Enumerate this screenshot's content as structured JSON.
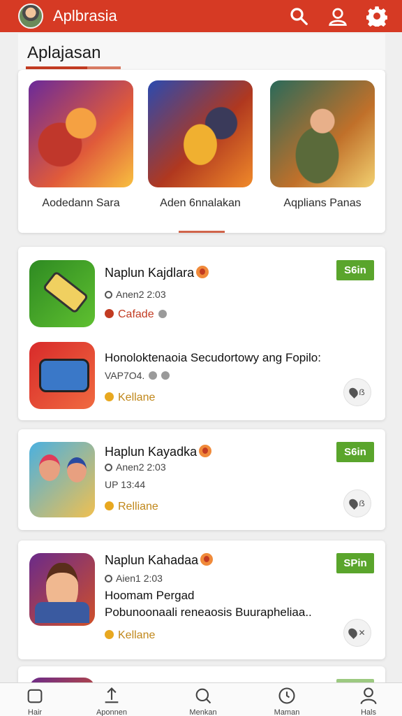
{
  "header": {
    "app_title": "Aplbrasia",
    "icons": [
      "search-icon",
      "profile-icon",
      "settings-icon"
    ],
    "accent_color": "#d63a24"
  },
  "section": {
    "title": "Aplajasan"
  },
  "featured": [
    {
      "label": "Aodedann Sara"
    },
    {
      "label": "Aden 6nnalakan"
    },
    {
      "label": "Aqplians Panas"
    }
  ],
  "apps": [
    {
      "title": "Naplun Kajdlara",
      "time": "Anen2 2:03",
      "category": "Cafade",
      "category_color": "#c23b22",
      "badge": "S6in"
    },
    {
      "title": "Honoloktenaoia Secudortowy ang Fopilo:",
      "time": "VAP7O4.",
      "category": "Kellane",
      "category_color": "#c0871a",
      "button": "ẞ"
    },
    {
      "title": "Haplun Kayadka",
      "time": "Anen2 2:03",
      "sub": "UP 13:44",
      "category": "Relliane",
      "category_color": "#c0871a",
      "badge": "S6in",
      "button": "ẞ"
    },
    {
      "title": "Naplun Kahadaa",
      "time": "Aien1 2:03",
      "line1": "Hoomam Pergad",
      "line2": "Pobunoonaali reneaosis Buurapheliaa..",
      "category": "Kellane",
      "category_color": "#c0871a",
      "badge": "SPin",
      "button": "✕"
    }
  ],
  "bottom_nav": [
    {
      "label": "Hair",
      "icon": "home-icon"
    },
    {
      "label": "Aponnen",
      "icon": "upload-icon"
    },
    {
      "label": "Menkan",
      "icon": "search-icon"
    },
    {
      "label": "Maman",
      "icon": "clock-icon"
    },
    {
      "label": "Hals",
      "icon": "profile-icon"
    }
  ]
}
